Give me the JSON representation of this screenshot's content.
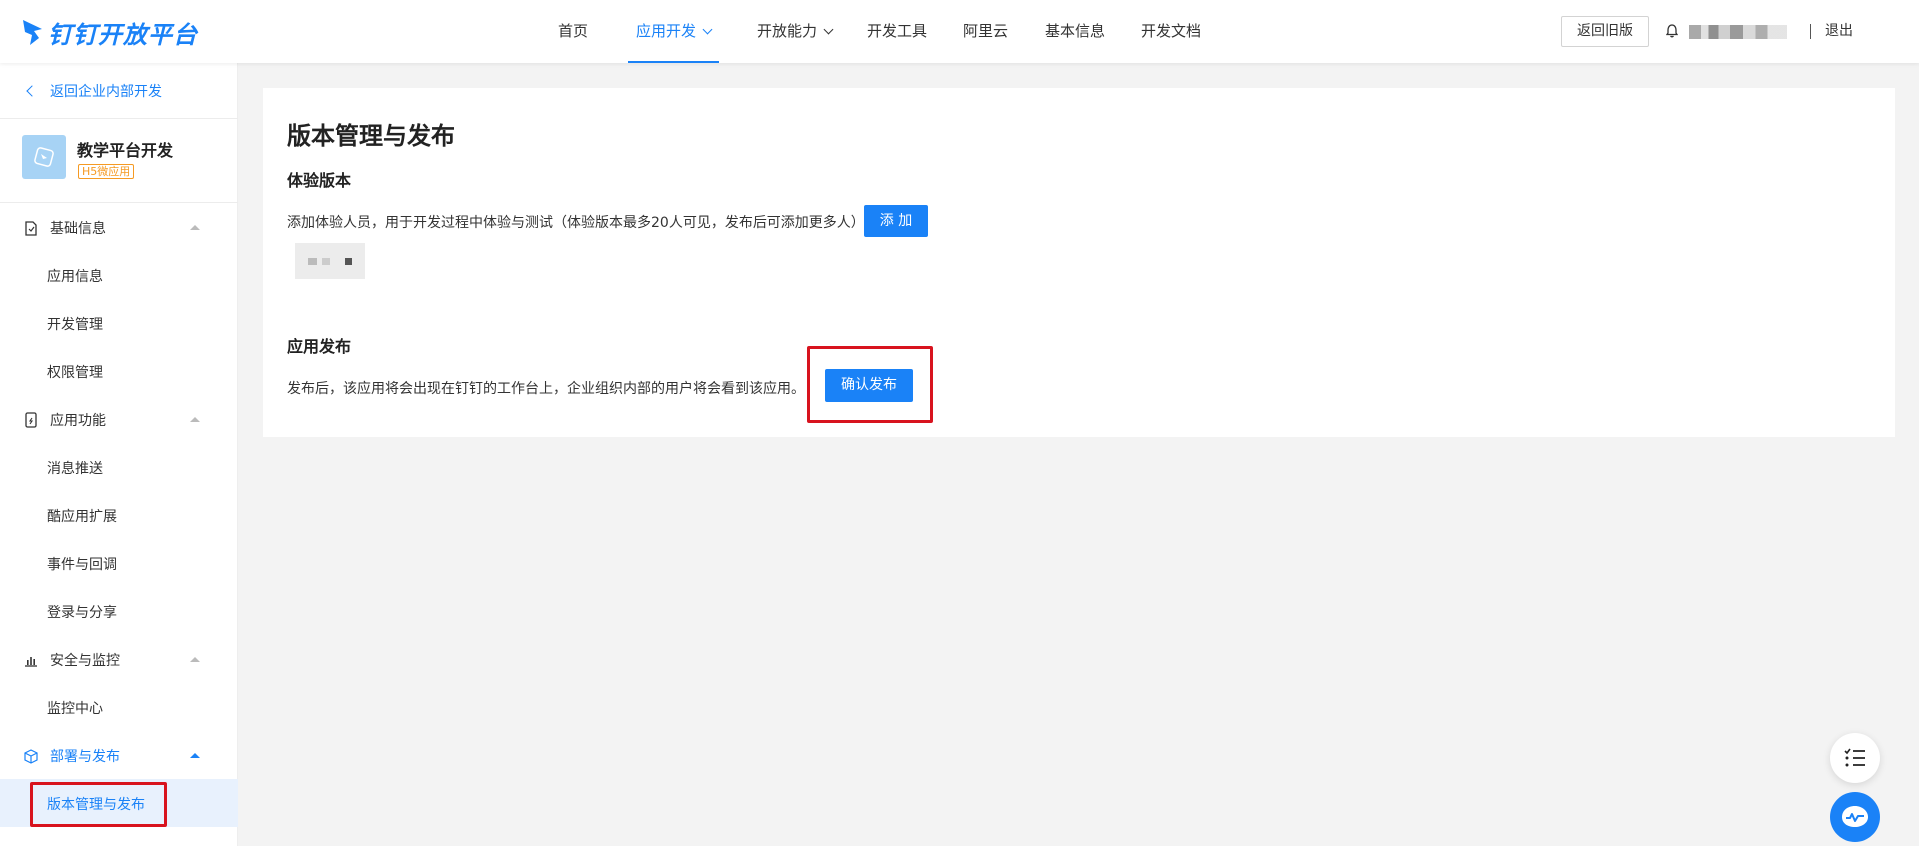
{
  "header": {
    "logo_text": "钉钉开放平台",
    "nav": [
      "首页",
      "应用开发",
      "开放能力",
      "开发工具",
      "阿里云",
      "基本信息",
      "开发文档"
    ],
    "back_old_label": "返回旧版",
    "logout_label": "退出"
  },
  "sidebar": {
    "back_label": "返回企业内部开发",
    "app": {
      "name": "教学平台开发",
      "tag": "H5微应用"
    },
    "sections": [
      {
        "label": "基础信息",
        "icon": "document-icon",
        "items": [
          "应用信息",
          "开发管理",
          "权限管理"
        ]
      },
      {
        "label": "应用功能",
        "icon": "phone-icon",
        "items": [
          "消息推送",
          "酷应用扩展",
          "事件与回调",
          "登录与分享"
        ]
      },
      {
        "label": "安全与监控",
        "icon": "bar-chart-icon",
        "items": [
          "监控中心"
        ]
      },
      {
        "label": "部署与发布",
        "icon": "cube-icon",
        "items": [
          "版本管理与发布"
        ]
      }
    ]
  },
  "main": {
    "title": "版本管理与发布",
    "trial": {
      "heading": "体验版本",
      "desc": "添加体验人员，用于开发过程中体验与测试（体验版本最多20人可见，发布后可添加更多人）",
      "add_label": "添 加"
    },
    "publish": {
      "heading": "应用发布",
      "desc": "发布后，该应用将会出现在钉钉的工作台上，企业组织内部的用户将会看到该应用。",
      "confirm_label": "确认发布"
    }
  },
  "colors": {
    "accent": "#1a82f7",
    "highlight": "#d8131e",
    "background": "#f3f3f3"
  }
}
